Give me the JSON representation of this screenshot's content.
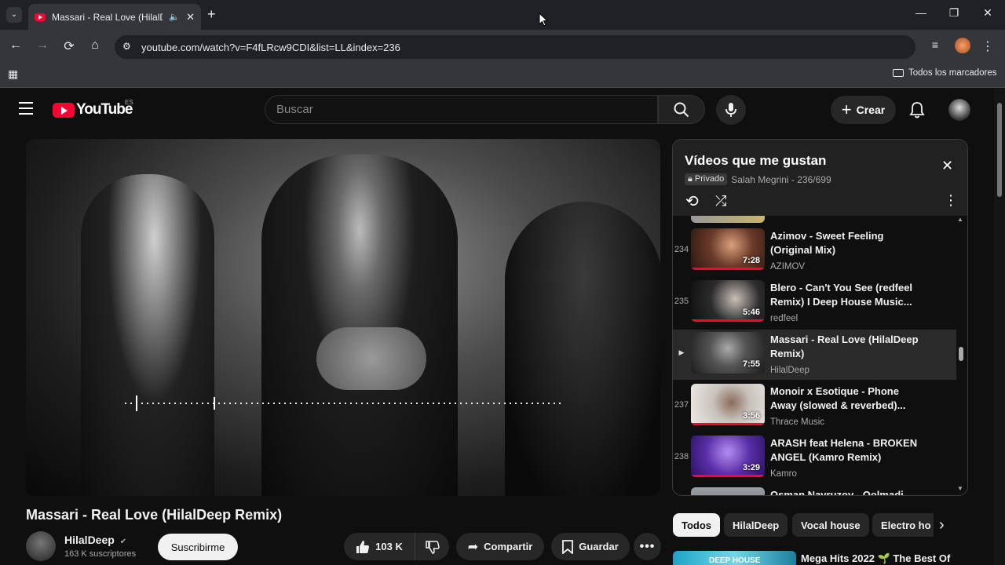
{
  "browser": {
    "tab_title": "Massari - Real Love (HilalDe",
    "url": "youtube.com/watch?v=F4fLRcw9CDI&list=LL&index=236",
    "bookmarks_label": "Todos los marcadores"
  },
  "header": {
    "logo_text": "YouTube",
    "region": "ES",
    "search_placeholder": "Buscar",
    "create_label": "Crear"
  },
  "video": {
    "title": "Massari - Real Love (HilalDeep Remix)",
    "channel": "HilalDeep",
    "subscribers": "163 K suscriptores",
    "subscribe_label": "Suscribirme",
    "likes": "103 K",
    "share_label": "Compartir",
    "save_label": "Guardar"
  },
  "playlist": {
    "title": "Vídeos que me gustan",
    "privacy": "Privado",
    "owner_position": "Salah Megrini - 236/699",
    "items": [
      {
        "index": "234",
        "title": "Azimov - Sweet Feeling (Original Mix)",
        "channel": "AZIMOV",
        "duration": "7:28",
        "thumb_color": "#6b3a2a"
      },
      {
        "index": "235",
        "title": "Blero - Can't You See (redfeel Remix) I Deep House Music...",
        "channel": "redfeel",
        "duration": "5:46",
        "thumb_color": "#2b2b2b"
      },
      {
        "index": "",
        "title": "Massari - Real Love (HilalDeep Remix)",
        "channel": "HilalDeep",
        "duration": "7:55",
        "thumb_color": "#555555"
      },
      {
        "index": "237",
        "title": "Monoir x Esotique - Phone Away (slowed & reverbed)...",
        "channel": "Thrace Music",
        "duration": "3:56",
        "thumb_color": "#c8c2bc"
      },
      {
        "index": "238",
        "title": "ARASH feat Helena - BROKEN ANGEL (Kamro Remix)",
        "channel": "Kamro",
        "duration": "3:29",
        "thumb_color": "#5a2ea8"
      },
      {
        "index": "",
        "title": "Osman Navruzov - Qolmadi",
        "channel": "",
        "duration": "",
        "thumb_color": "#8a8a8a"
      }
    ]
  },
  "chips": [
    "Todos",
    "HilalDeep",
    "Vocal house",
    "Electro ho"
  ],
  "recommended": {
    "title": "Mega Hits 2022 🌱 The Best Of",
    "thumb_text": "DEEP HOUSE"
  },
  "colors": {
    "accent": "#ff0033",
    "background": "#0f0f0f"
  }
}
